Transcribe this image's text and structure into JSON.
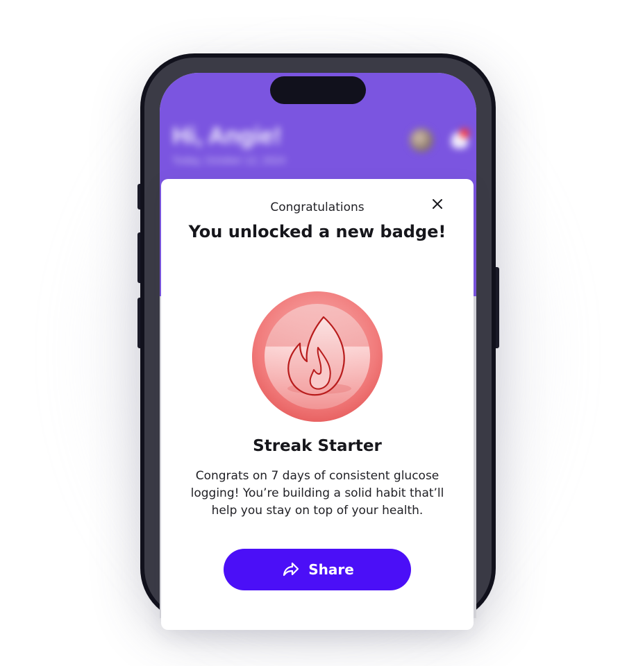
{
  "background": {
    "greeting": "Hi, Angie!",
    "date": "Today, October 12, 2024"
  },
  "modal": {
    "kicker": "Congratulations",
    "title": "You unlocked a new badge!",
    "close_icon": "close-icon",
    "badge": {
      "icon": "flame-icon",
      "name": "Streak Starter",
      "description": "Congrats on 7 days of consistent glucose logging! You’re building a solid habit that’ll help you stay on top of your health."
    },
    "share": {
      "label": "Share",
      "icon": "share-arrow-icon"
    }
  },
  "colors": {
    "brand_purple": "#7b55e0",
    "button_blue": "#4b0ff7",
    "badge_red": "#ef5f5f",
    "notification_dot": "#ff3b3b"
  }
}
